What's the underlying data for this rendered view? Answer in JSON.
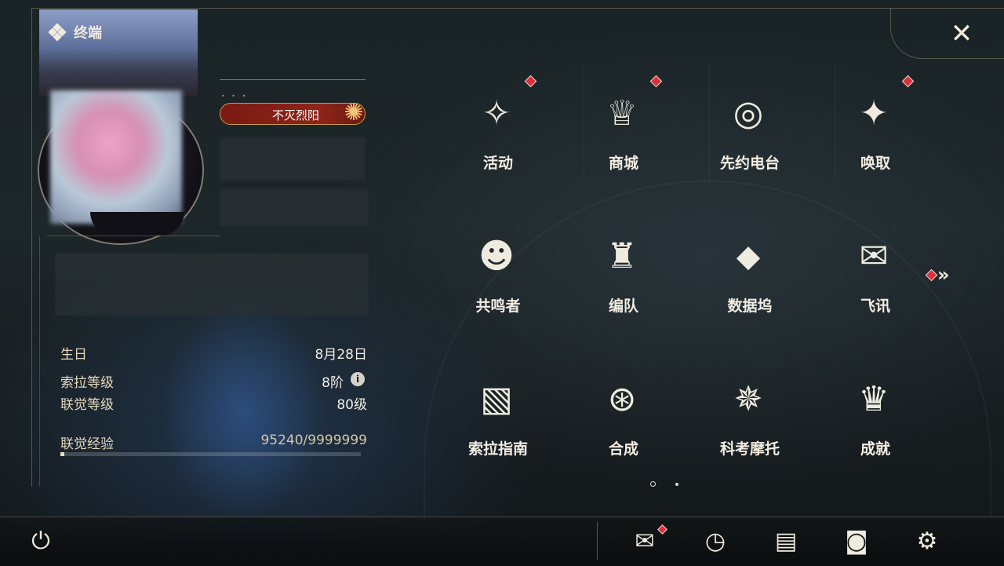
{
  "header": {
    "title": "终端",
    "icon": "diamond-cluster-icon"
  },
  "profile": {
    "title_badge": "不灭烈阳",
    "stats": [
      {
        "label": "生日",
        "value": "8月28日"
      },
      {
        "label": "索拉等级",
        "value": "8阶"
      },
      {
        "label": "联觉等级",
        "value": "80级"
      },
      {
        "label": "联觉经验",
        "value": "95240/9999999"
      }
    ],
    "info_icon_label": "i",
    "exp_fraction": 0.0095
  },
  "grid": [
    {
      "label": "活动",
      "icon": "sparkle-slash-icon",
      "glyph": "✧",
      "badge": true
    },
    {
      "label": "商城",
      "icon": "shop-cart-icon",
      "glyph": "♕",
      "badge": true
    },
    {
      "label": "先约电台",
      "icon": "radio-disc-icon",
      "glyph": "◎",
      "badge": false
    },
    {
      "label": "唤取",
      "icon": "compass-star-icon",
      "glyph": "✦",
      "badge": true
    },
    {
      "label": "共鸣者",
      "icon": "character-head-icon",
      "glyph": "☻",
      "badge": false
    },
    {
      "label": "编队",
      "icon": "chess-pieces-icon",
      "glyph": "♜",
      "badge": false
    },
    {
      "label": "数据坞",
      "icon": "data-dock-icon",
      "glyph": "⬥",
      "badge": false
    },
    {
      "label": "飞讯",
      "icon": "chat-bubble-icon",
      "glyph": "✉",
      "badge": false
    },
    {
      "label": "索拉指南",
      "icon": "guide-book-icon",
      "glyph": "▧",
      "badge": false
    },
    {
      "label": "合成",
      "icon": "synthesis-icon",
      "glyph": "⊛",
      "badge": false
    },
    {
      "label": "科考摩托",
      "icon": "motorbike-icon",
      "glyph": "✵",
      "badge": false
    },
    {
      "label": "成就",
      "icon": "trophy-icon",
      "glyph": "♛",
      "badge": false
    }
  ],
  "more": {
    "glyph": "»",
    "icon": "double-chevron-right-icon"
  },
  "close": {
    "glyph": "✕",
    "icon": "close-icon"
  },
  "bottom": {
    "power": {
      "glyph": "⏻",
      "icon": "power-icon"
    },
    "actions": [
      {
        "name": "mail",
        "glyph": "✉",
        "icon": "mail-icon",
        "badge": true
      },
      {
        "name": "time",
        "glyph": "◷",
        "icon": "clock-icon",
        "badge": false
      },
      {
        "name": "notes",
        "glyph": "▤",
        "icon": "notes-icon",
        "badge": false
      },
      {
        "name": "camera",
        "glyph": "◙",
        "icon": "camera-icon",
        "badge": false
      },
      {
        "name": "settings",
        "glyph": "⚙",
        "icon": "gear-icon",
        "badge": false
      }
    ]
  }
}
